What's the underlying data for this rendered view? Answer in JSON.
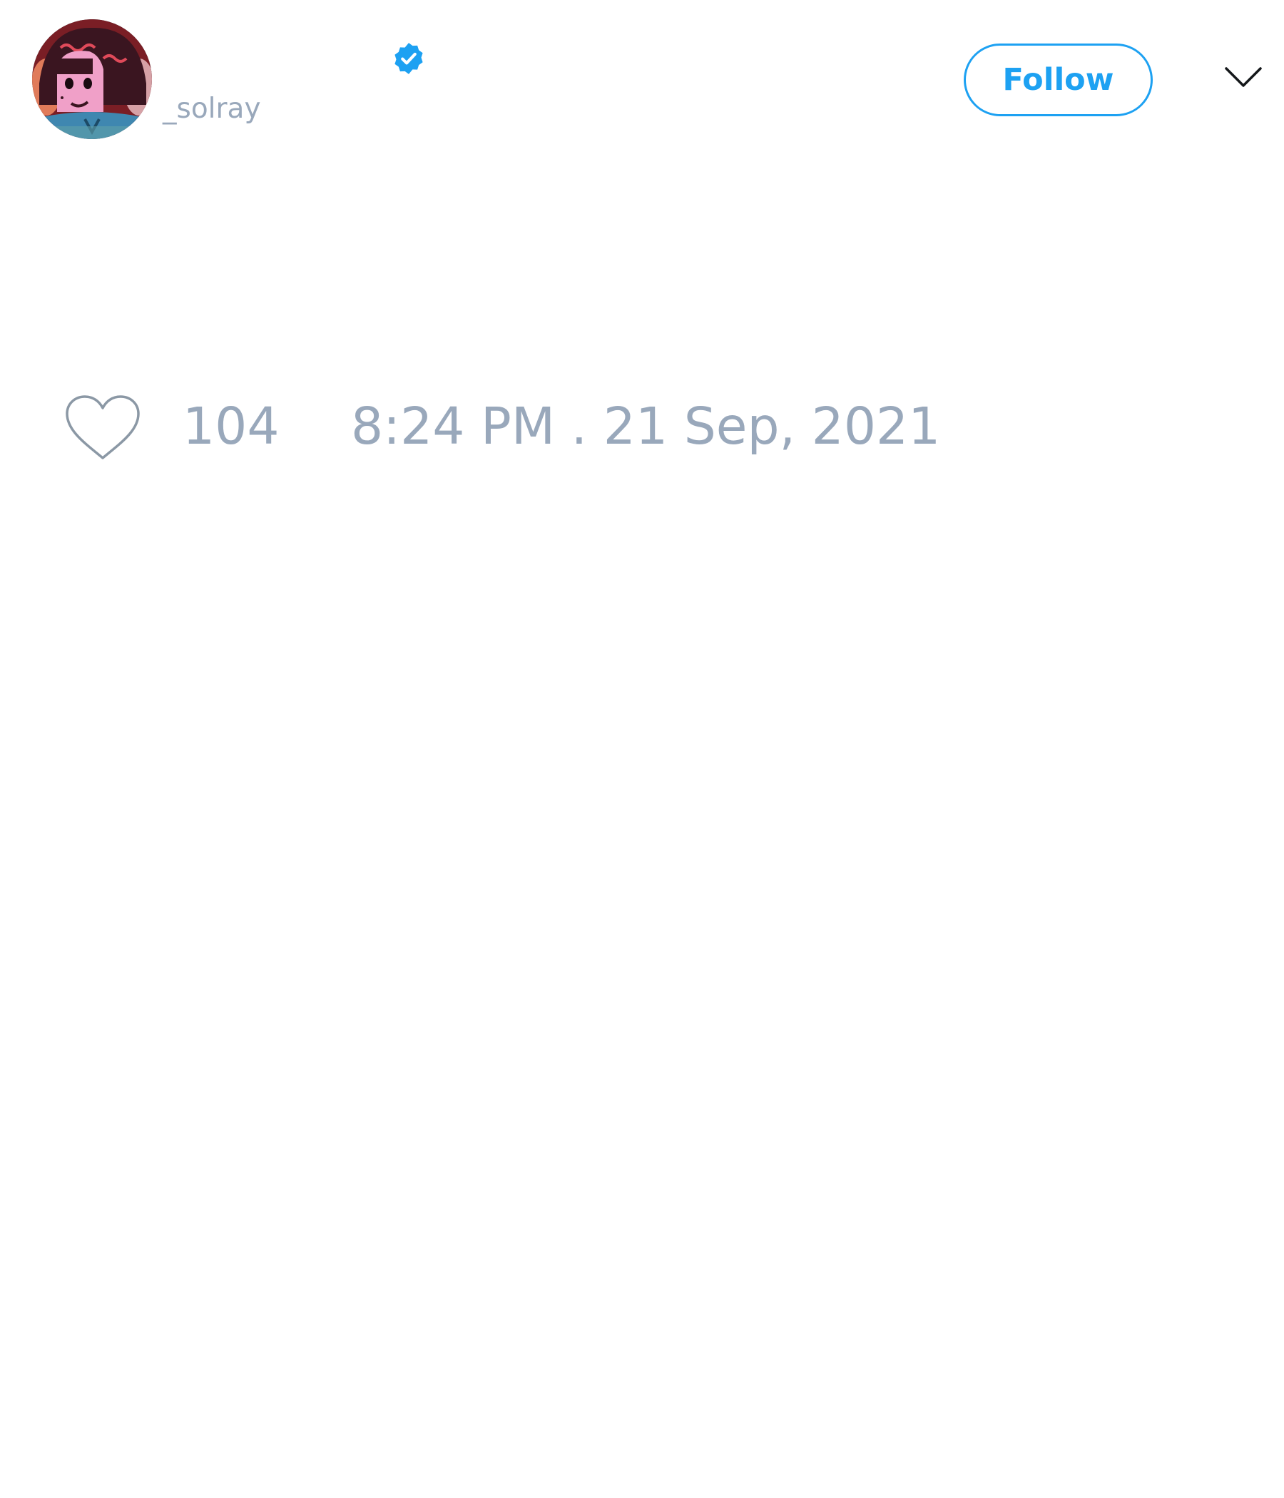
{
  "tweet": {
    "author": {
      "handle": "_solray",
      "verified": true,
      "avatar": "avatar-illustration"
    },
    "follow_label": "Follow",
    "more_icon": "chevron-down-icon",
    "like_icon": "heart-outline-icon",
    "likes": "104",
    "timestamp": "8:24 PM . 21 Sep, 2021"
  },
  "colors": {
    "accent": "#1da1f2",
    "muted_text": "#99a8bb",
    "background": "#ffffff"
  }
}
